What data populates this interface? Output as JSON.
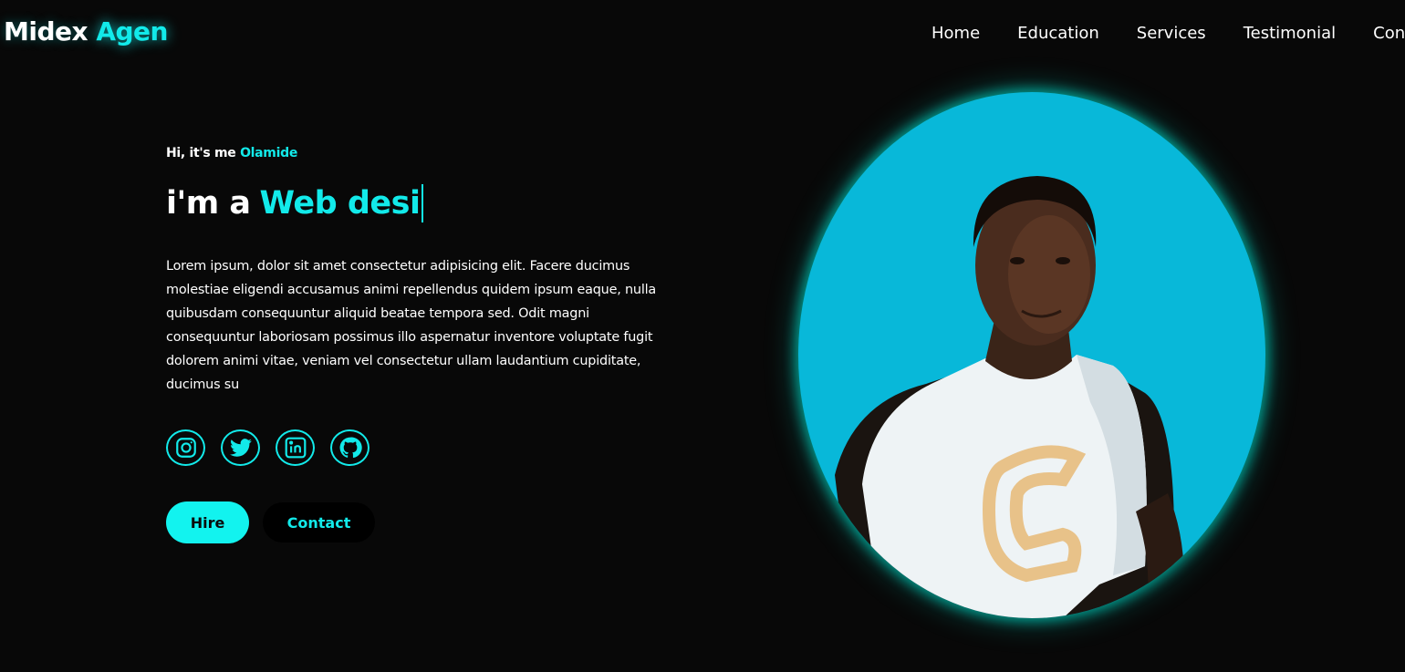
{
  "header": {
    "logo_main": "Midex",
    "logo_accent": "Agen",
    "nav": [
      "Home",
      "Education",
      "Services",
      "Testimonial",
      "Contact"
    ]
  },
  "hero": {
    "greeting_prefix": "Hi, it's me",
    "greeting_name": "Olamide",
    "headline_prefix": "i'm a",
    "headline_typed": "Web desi",
    "bio": "Lorem ipsum, dolor sit amet consectetur adipisicing elit. Facere ducimus molestiae eligendi accusamus animi repellendus quidem ipsum eaque, nulla quibusdam consequuntur aliquid beatae tempora sed. Odit magni consequuntur laboriosam possimus illo aspernatur inventore voluptate fugit dolorem animi vitae, veniam vel consectetur ullam laudantium cupiditate, ducimus su",
    "socials": [
      "instagram-icon",
      "twitter-icon",
      "linkedin-icon",
      "github-icon"
    ],
    "hire_label": "Hire",
    "contact_label": "Contact"
  },
  "theme": {
    "accent": "#12eaea",
    "background": "#080808",
    "portrait_bg": "#08b8d9"
  }
}
